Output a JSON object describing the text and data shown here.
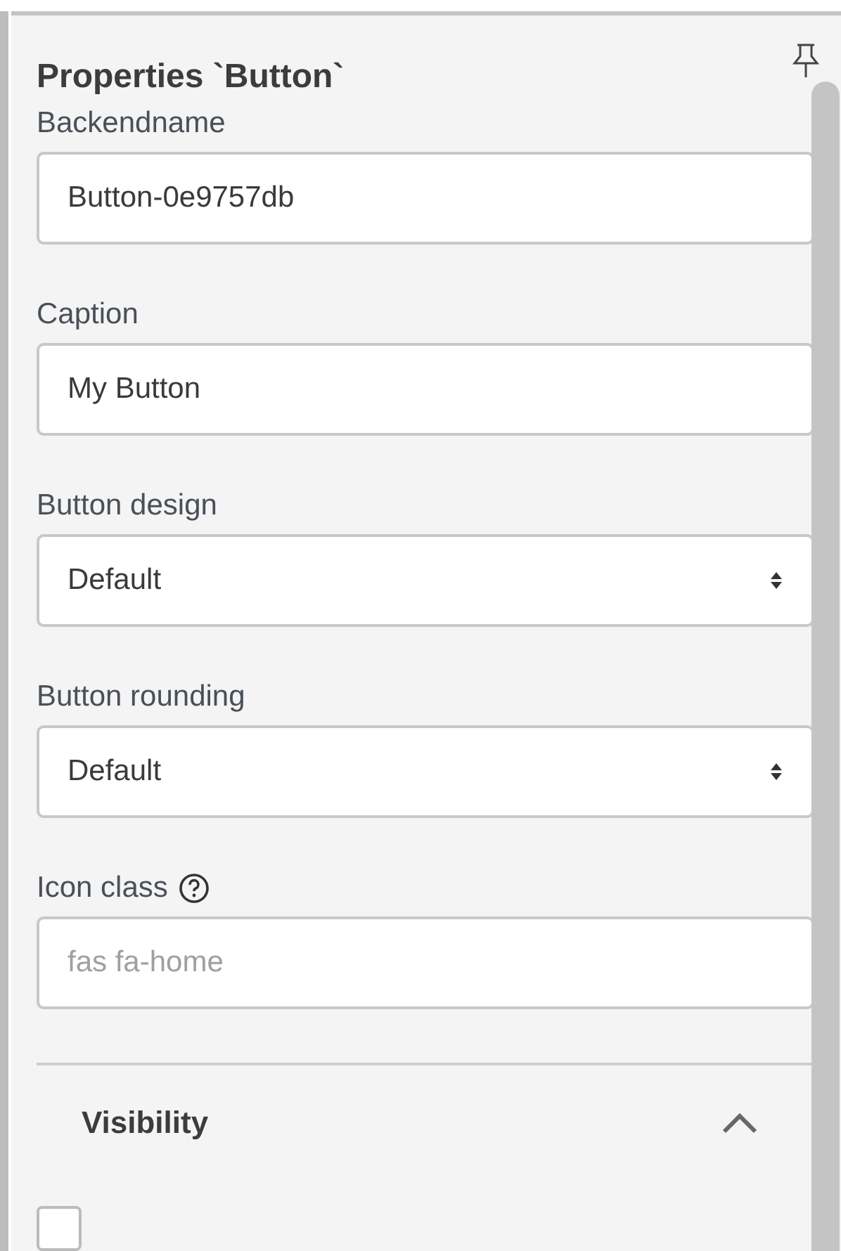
{
  "panel": {
    "title": "Properties `Button`",
    "pinned": false
  },
  "fields": [
    {
      "kind": "text",
      "label": "Backendname",
      "value": "Button-0e9757db"
    },
    {
      "kind": "text",
      "label": "Caption",
      "value": "My Button"
    },
    {
      "kind": "select",
      "label": "Button design",
      "value": "Default"
    },
    {
      "kind": "select",
      "label": "Button rounding",
      "value": "Default"
    },
    {
      "kind": "text",
      "label": "Icon class",
      "help": true,
      "placeholder": "fas fa-home"
    }
  ],
  "section": {
    "title": "Visibility",
    "expanded": true,
    "checkbox": {
      "checked": false
    }
  }
}
